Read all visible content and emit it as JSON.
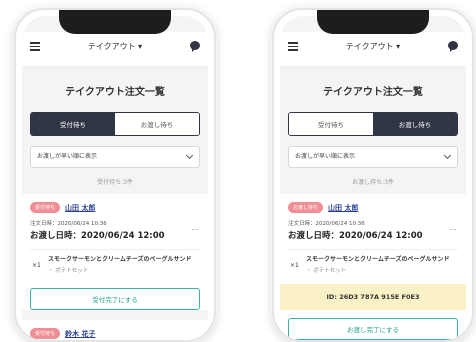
{
  "screens": [
    {
      "store_selector": "テイクアウト ▾",
      "page_title": "テイクアウト注文一覧",
      "tabs": [
        {
          "label": "受付待ち",
          "active": true
        },
        {
          "label": "お渡し待ち",
          "active": false
        }
      ],
      "sort_label": "お渡しが早い順に表示",
      "count_label": "受付待ち:3件",
      "orders": [
        {
          "badge": "受付待ち",
          "customer": "山田 太郎",
          "order_date": "注文日時：2020/06/24 10:36",
          "more": "…",
          "delivery_date": "お渡し日時：2020/06/24 12:00",
          "items": [
            {
              "qty": "×1",
              "name": "スモークサーモンとクリームチーズのベーグルサンド",
              "option": "・ ポテトセット"
            }
          ],
          "action_label": "受付完了にする"
        },
        {
          "badge": "受付待ち",
          "customer": "鈴木 花子"
        }
      ]
    },
    {
      "store_selector": "テイクアウト ▾",
      "page_title": "テイクアウト注文一覧",
      "tabs": [
        {
          "label": "受付待ち",
          "active": false
        },
        {
          "label": "お渡し待ち",
          "active": true
        }
      ],
      "sort_label": "お渡しが早い順に表示",
      "count_label": "お渡し待ち:3件",
      "orders": [
        {
          "badge": "お渡し待ち",
          "customer": "山田 太郎",
          "order_date": "注文日時：2020/06/24 10:36",
          "more": "…",
          "delivery_date": "お渡し日時：2020/06/24 12:00",
          "items": [
            {
              "qty": "×1",
              "name": "スモークサーモンとクリームチーズのベーグルサンド",
              "option": "・ ポテトセット"
            }
          ],
          "order_id": "ID: 26D3 787A 915E F0E3",
          "action_label": "お渡し完了にする"
        }
      ]
    }
  ],
  "colors": {
    "tab_active": "#2f3542",
    "badge": "#f08e95",
    "customer_link": "#2a3f8f",
    "action_border": "#3bb3a2",
    "id_highlight": "#fbf1c6"
  }
}
